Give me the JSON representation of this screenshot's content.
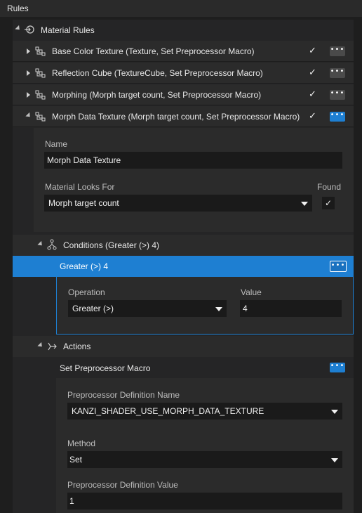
{
  "header": {
    "title": "Rules"
  },
  "tree": {
    "material_rules_label": "Material Rules",
    "rules": [
      {
        "label": "Base Color Texture (Texture, Set Preprocessor Macro)",
        "enabled_check": "✓",
        "more": "•••"
      },
      {
        "label": "Reflection Cube (TextureCube, Set Preprocessor Macro)",
        "enabled_check": "✓",
        "more": "•••"
      },
      {
        "label": "Morphing (Morph target count, Set Preprocessor Macro)",
        "enabled_check": "✓",
        "more": "•••"
      },
      {
        "label": "Morph Data Texture (Morph target count, Set Preprocessor Macro)",
        "enabled_check": "✓",
        "more": "•••"
      }
    ]
  },
  "rule_details": {
    "name_label": "Name",
    "name_value": "Morph Data Texture",
    "looks_for_label": "Material Looks For",
    "looks_for_value": "Morph target count",
    "found_label": "Found",
    "found_check": "✓"
  },
  "conditions": {
    "label": "Conditions (Greater (>) 4)",
    "item_label": "Greater (>) 4",
    "more": "•••",
    "operation_label": "Operation",
    "operation_value": "Greater (>)",
    "value_label": "Value",
    "value_value": "4"
  },
  "actions": {
    "label": "Actions",
    "item_label": "Set Preprocessor Macro",
    "more": "•••",
    "def_name_label": "Preprocessor Definition Name",
    "def_name_value": "KANZI_SHADER_USE_MORPH_DATA_TEXTURE",
    "method_label": "Method",
    "method_value": "Set",
    "def_value_label": "Preprocessor Definition Value",
    "def_value_value": "1"
  },
  "colors": {
    "selection": "#1e7fd2",
    "background": "#1e1e1e",
    "row": "#2b2b2b",
    "input": "#1a1a1a"
  }
}
